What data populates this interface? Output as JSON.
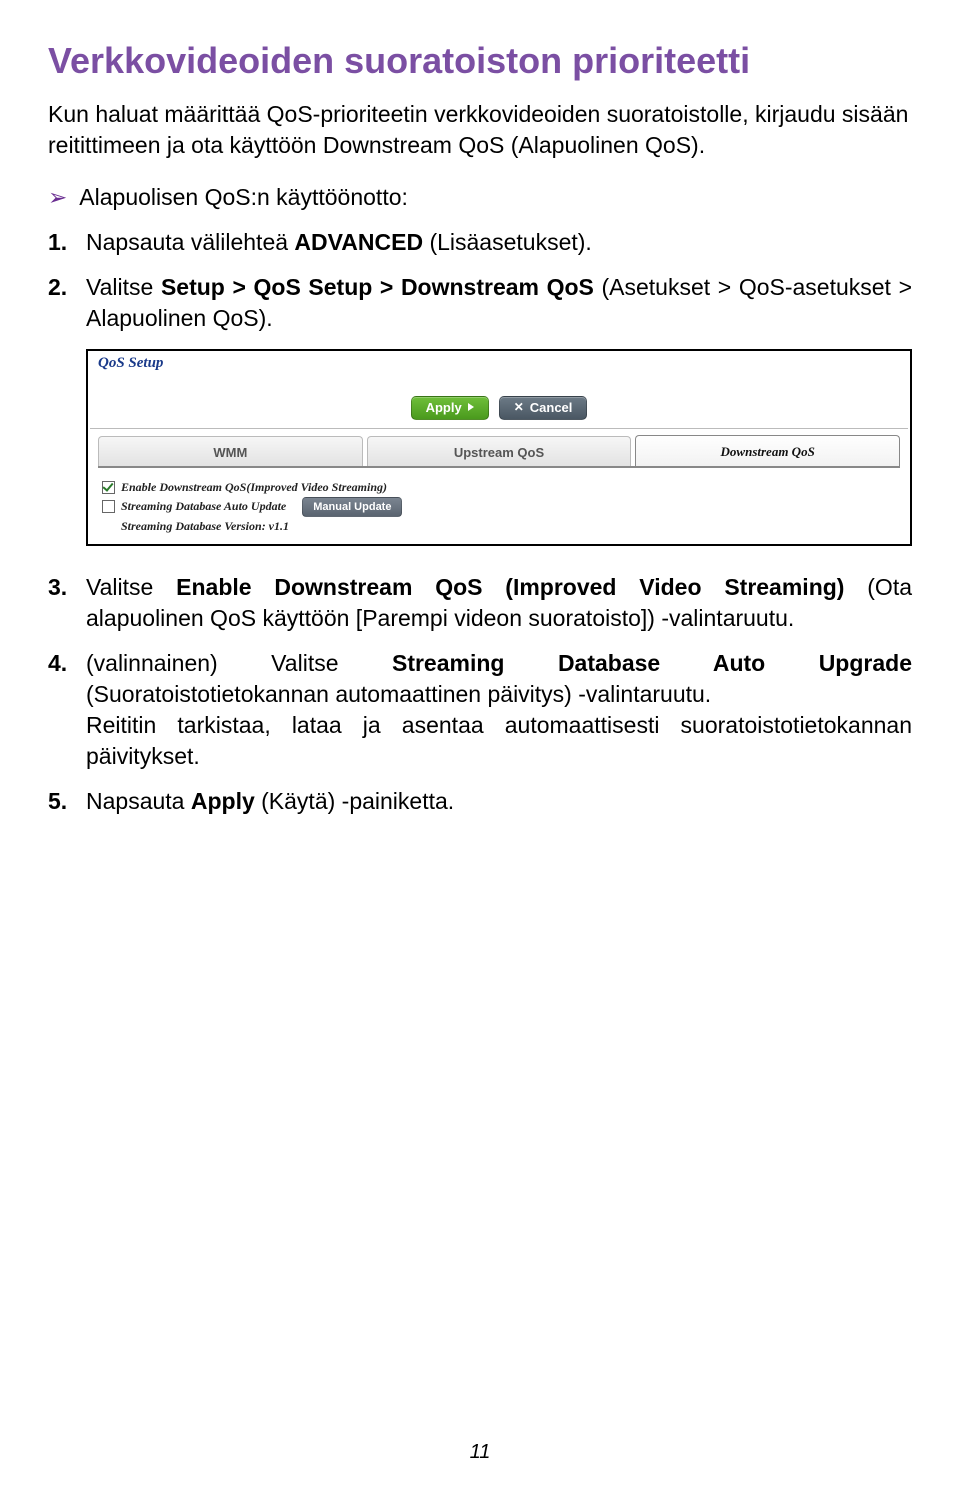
{
  "title": "Verkkovideoiden suoratoiston prioriteetti",
  "intro": "Kun haluat määrittää QoS-prioriteetin verkkovideoiden suoratoistolle, kirjaudu sisään reitittimeen ja ota käyttöön Downstream QoS (Alapuolinen QoS).",
  "bullet": "Alapuolisen QoS:n käyttöönotto:",
  "steps": {
    "s1": {
      "num": "1.",
      "pre": "Napsauta välilehteä ",
      "bold": "ADVANCED",
      "post": " (Lisäasetukset)."
    },
    "s2": {
      "num": "2.",
      "pre": "Valitse ",
      "bold": "Setup > QoS Setup > Downstream QoS",
      "post": " (Asetukset > QoS-asetukset > Alapuolinen QoS)."
    },
    "s3": {
      "num": "3.",
      "pre": "Valitse ",
      "bold": "Enable Downstream QoS (Improved Video Streaming)",
      "post": " (Ota alapuolinen QoS käyttöön [Parempi videon suoratoisto]) -valintaruutu."
    },
    "s4": {
      "num": "4.",
      "pre": "(valinnainen) Valitse ",
      "bold": "Streaming Database Auto Upgrade",
      "post": " (Suoratoistotietokannan automaattinen päivitys) -valintaruutu.",
      "tail": "Reititin tarkistaa, lataa ja asentaa automaattisesti suoratoistotietokannan päivitykset."
    },
    "s5": {
      "num": "5.",
      "pre": "Napsauta ",
      "bold": "Apply",
      "post": " (Käytä) -painiketta."
    }
  },
  "screenshot": {
    "panel_title": "QoS Setup",
    "apply": "Apply",
    "cancel": "Cancel",
    "tabs": {
      "wmm": "WMM",
      "upstream": "Upstream QoS",
      "downstream": "Downstream QoS"
    },
    "opt_enable": "Enable Downstream QoS(Improved Video Streaming)",
    "opt_auto": "Streaming Database Auto Update",
    "manual": "Manual Update",
    "version": "Streaming Database Version: v1.1"
  },
  "page": "11"
}
